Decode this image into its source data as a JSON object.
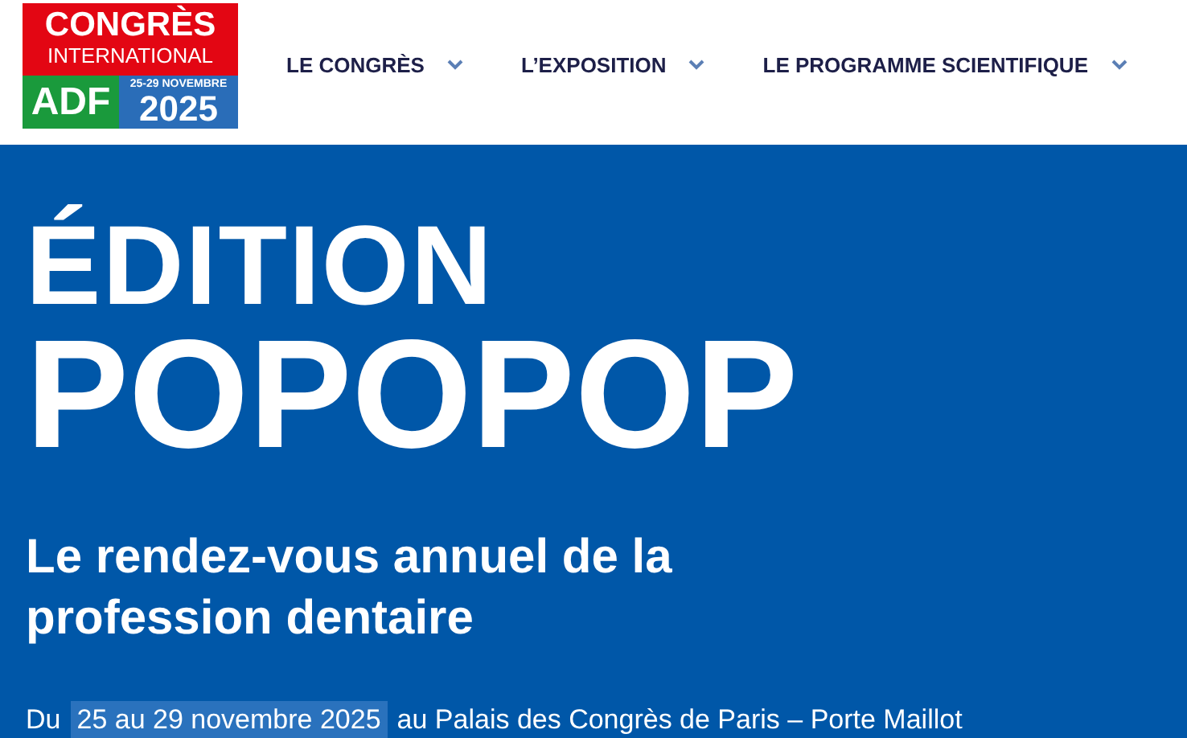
{
  "logo": {
    "line_1": "CONGRÈS",
    "line_2": "INTERNATIONAL",
    "acronym": "ADF",
    "dates": "25-29 NOVEMBRE",
    "year": "2025"
  },
  "nav": [
    {
      "label": "LE CONGRÈS"
    },
    {
      "label": "L’EXPOSITION"
    },
    {
      "label": "LE PROGRAMME SCIENTIFIQUE"
    }
  ],
  "hero": {
    "title_1": "ÉDITION",
    "title_2": "POPOPOP",
    "subtitle": "Le rendez-vous annuel de la profession dentaire",
    "date_prefix": "Du",
    "date_highlight": "25 au 29 novembre 2025",
    "date_suffix": "au Palais des Congrès de Paris – Porte Maillot"
  }
}
